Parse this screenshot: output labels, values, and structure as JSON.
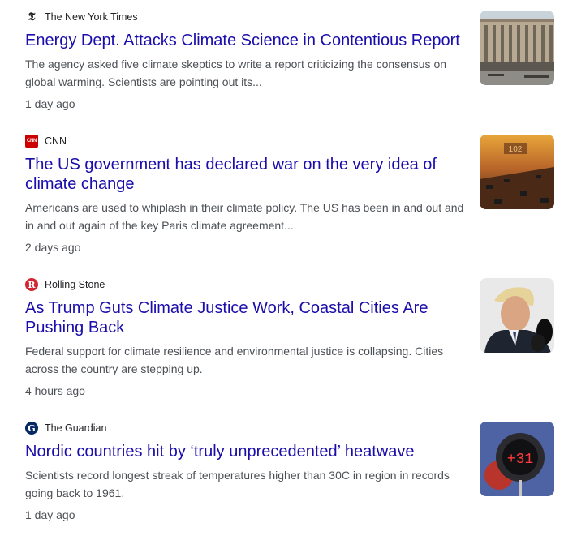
{
  "articles": [
    {
      "source": "The New York Times",
      "favicon": "nyt-logo-icon",
      "headline": "Energy Dept. Attacks Climate Science in Contentious Report",
      "snippet": "The agency asked five climate skeptics to write a report criticizing the consensus on global warming. Scientists are pointing out its...",
      "age": "1 day ago",
      "thumbnail": "building-photo"
    },
    {
      "source": "CNN",
      "favicon": "cnn-logo-icon",
      "headline": "The US government has declared war on the very idea of climate change",
      "snippet": "Americans are used to whiplash in their climate policy. The US has been in and out and in and out again of the key Paris climate agreement...",
      "age": "2 days ago",
      "thumbnail": "highway-heat-photo",
      "thumbnail_sign": "102"
    },
    {
      "source": "Rolling Stone",
      "favicon": "rolling-stone-logo-icon",
      "headline": "As Trump Guts Climate Justice Work, Coastal Cities Are Pushing Back",
      "snippet": "Federal support for climate resilience and environmental justice is collapsing. Cities across the country are stepping up.",
      "age": "4 hours ago",
      "thumbnail": "portrait-photo"
    },
    {
      "source": "The Guardian",
      "favicon": "guardian-logo-icon",
      "headline": "Nordic countries hit by ‘truly unprecedented’ heatwave",
      "snippet": "Scientists record longest streak of temperatures higher than 30C in region in records going back to 1961.",
      "age": "1 day ago",
      "thumbnail": "thermometer-photo",
      "thumbnail_reading": "+31"
    }
  ],
  "colors": {
    "headline": "#1a0dab",
    "snippet": "#4d5156",
    "cnn_red": "#cc0000",
    "rolling_stone_red": "#d32531"
  }
}
